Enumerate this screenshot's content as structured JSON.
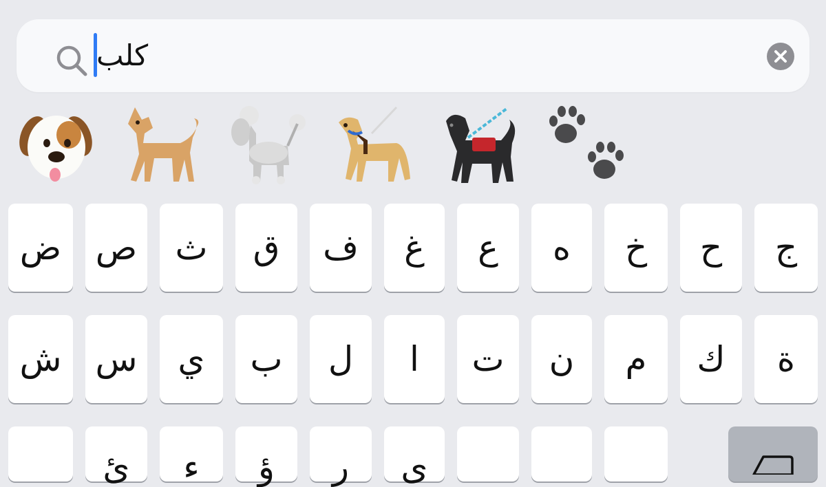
{
  "search": {
    "query": "كلب",
    "icon": "search-icon",
    "clear_icon": "clear-icon"
  },
  "emoji_suggestions": [
    {
      "name": "dog-face-icon",
      "char": "🐶"
    },
    {
      "name": "dog-icon",
      "char": "🐕"
    },
    {
      "name": "poodle-icon",
      "char": "🐩"
    },
    {
      "name": "guide-dog-icon",
      "char": "🦮"
    },
    {
      "name": "service-dog-icon",
      "char": "🐕‍🦺"
    },
    {
      "name": "paw-prints-icon",
      "char": "🐾"
    }
  ],
  "keyboard": {
    "row1": [
      "ض",
      "ص",
      "ث",
      "ق",
      "ف",
      "غ",
      "ع",
      "ه",
      "خ",
      "ح",
      "ج"
    ],
    "row2": [
      "ش",
      "س",
      "ي",
      "ب",
      "ل",
      "ا",
      "ت",
      "ن",
      "م",
      "ك",
      "ة"
    ],
    "row3_visible_fragments": [
      "",
      "ئ",
      "ء",
      "ؤ",
      "ر",
      "ى",
      "",
      "",
      ""
    ],
    "backspace_icon": "backspace-icon"
  },
  "colors": {
    "background": "#e9eaee",
    "search_field": "#f8f9fb",
    "caret": "#2f7bf5",
    "key": "#ffffff",
    "special_key": "#b0b4bb",
    "clear_button": "#8e8e93"
  }
}
